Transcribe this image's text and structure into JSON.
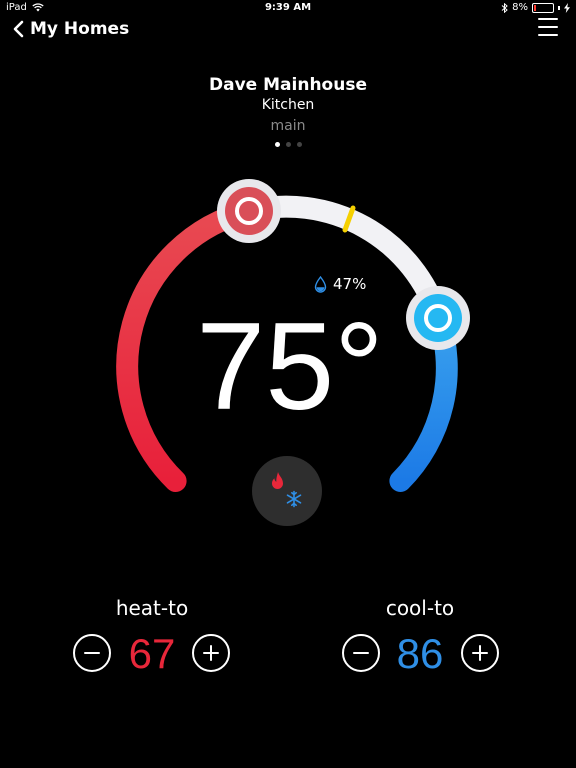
{
  "status_bar": {
    "device": "iPad",
    "time": "9:39 AM",
    "battery": "8%"
  },
  "nav": {
    "back_label": "My Homes"
  },
  "location": {
    "home": "Dave Mainhouse",
    "room": "Kitchen",
    "zone": "main",
    "page_count": 3,
    "active_page": 0
  },
  "thermostat": {
    "current_temp": "75°",
    "humidity": "47%",
    "heat_to_label": "heat-to",
    "heat_to_value": "67",
    "cool_to_label": "cool-to",
    "cool_to_value": "86"
  },
  "colors": {
    "heat": "#e8273a",
    "cool": "#2f8fe6",
    "track": "#f2f2f5",
    "indicator": "#f5d000"
  }
}
